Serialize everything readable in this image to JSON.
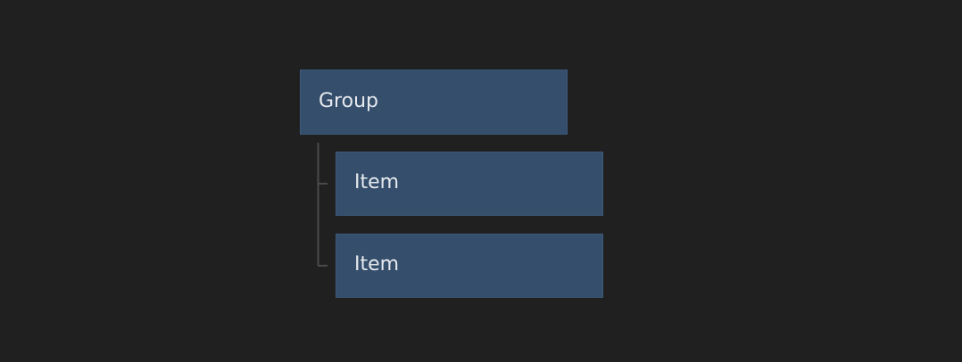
{
  "tree": {
    "group": {
      "label": "Group"
    },
    "items": [
      {
        "label": "Item"
      },
      {
        "label": "Item"
      }
    ]
  },
  "colors": {
    "background": "#202020",
    "node_fill": "#344e6c",
    "node_text": "#e6e9ee",
    "connector": "#4a4a4a"
  }
}
